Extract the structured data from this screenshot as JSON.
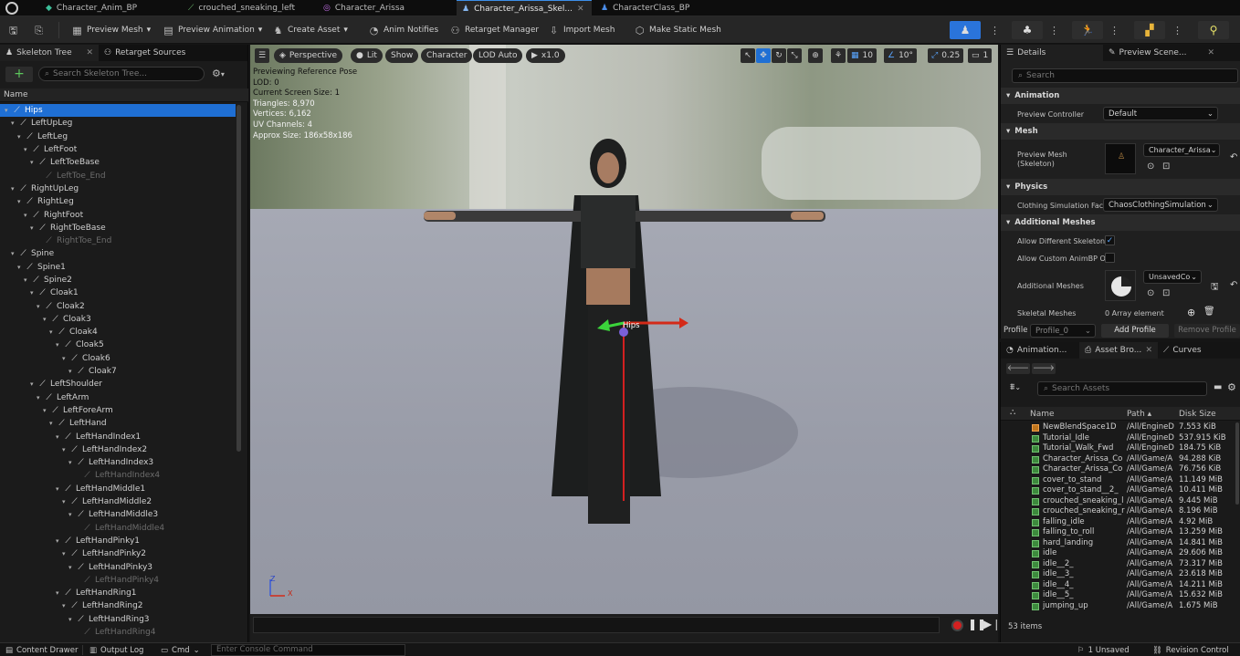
{
  "tabs": [
    {
      "label": "Character_Anim_BP",
      "icon": "anim-blueprint-icon"
    },
    {
      "label": "crouched_sneaking_left",
      "icon": "animation-icon"
    },
    {
      "label": "Character_Arissa",
      "icon": "skeletal-mesh-icon"
    },
    {
      "label": "Character_Arissa_Skel...",
      "icon": "skeleton-icon",
      "active": true
    },
    {
      "label": "CharacterClass_BP",
      "icon": "blueprint-icon"
    }
  ],
  "toolbar": {
    "preview_mesh": "Preview Mesh",
    "preview_animation": "Preview Animation",
    "create_asset": "Create Asset",
    "anim_notifies": "Anim Notifies",
    "retarget_manager": "Retarget Manager",
    "import_mesh": "Import Mesh",
    "make_static_mesh": "Make Static Mesh"
  },
  "left_panel": {
    "tab_skeleton_tree": "Skeleton Tree",
    "tab_retarget_sources": "Retarget Sources",
    "search_placeholder": "Search Skeleton Tree...",
    "column_name": "Name",
    "bones": [
      {
        "name": "Hips",
        "depth": 0,
        "selected": true
      },
      {
        "name": "LeftUpLeg",
        "depth": 1
      },
      {
        "name": "LeftLeg",
        "depth": 2
      },
      {
        "name": "LeftFoot",
        "depth": 3
      },
      {
        "name": "LeftToeBase",
        "depth": 4
      },
      {
        "name": "LeftToe_End",
        "depth": 5,
        "dim": true
      },
      {
        "name": "RightUpLeg",
        "depth": 1
      },
      {
        "name": "RightLeg",
        "depth": 2
      },
      {
        "name": "RightFoot",
        "depth": 3
      },
      {
        "name": "RightToeBase",
        "depth": 4
      },
      {
        "name": "RightToe_End",
        "depth": 5,
        "dim": true
      },
      {
        "name": "Spine",
        "depth": 1
      },
      {
        "name": "Spine1",
        "depth": 2
      },
      {
        "name": "Spine2",
        "depth": 3
      },
      {
        "name": "Cloak1",
        "depth": 4
      },
      {
        "name": "Cloak2",
        "depth": 5
      },
      {
        "name": "Cloak3",
        "depth": 6
      },
      {
        "name": "Cloak4",
        "depth": 7
      },
      {
        "name": "Cloak5",
        "depth": 8
      },
      {
        "name": "Cloak6",
        "depth": 9
      },
      {
        "name": "Cloak7",
        "depth": 10
      },
      {
        "name": "LeftShoulder",
        "depth": 4
      },
      {
        "name": "LeftArm",
        "depth": 5
      },
      {
        "name": "LeftForeArm",
        "depth": 6
      },
      {
        "name": "LeftHand",
        "depth": 7
      },
      {
        "name": "LeftHandIndex1",
        "depth": 8
      },
      {
        "name": "LeftHandIndex2",
        "depth": 9
      },
      {
        "name": "LeftHandIndex3",
        "depth": 10
      },
      {
        "name": "LeftHandIndex4",
        "depth": 11,
        "dim": true
      },
      {
        "name": "LeftHandMiddle1",
        "depth": 8
      },
      {
        "name": "LeftHandMiddle2",
        "depth": 9
      },
      {
        "name": "LeftHandMiddle3",
        "depth": 10
      },
      {
        "name": "LeftHandMiddle4",
        "depth": 11,
        "dim": true
      },
      {
        "name": "LeftHandPinky1",
        "depth": 8
      },
      {
        "name": "LeftHandPinky2",
        "depth": 9
      },
      {
        "name": "LeftHandPinky3",
        "depth": 10
      },
      {
        "name": "LeftHandPinky4",
        "depth": 11,
        "dim": true
      },
      {
        "name": "LeftHandRing1",
        "depth": 8
      },
      {
        "name": "LeftHandRing2",
        "depth": 9
      },
      {
        "name": "LeftHandRing3",
        "depth": 10
      },
      {
        "name": "LeftHandRing4",
        "depth": 11,
        "dim": true
      }
    ]
  },
  "viewport": {
    "perspective": "Perspective",
    "lit": "Lit",
    "show": "Show",
    "character": "Character",
    "lod": "LOD Auto",
    "speed": "x1.0",
    "grid_snap": "10",
    "rot_snap": "10°",
    "scale_snap": "0.25",
    "cam_speed": "1",
    "stats": {
      "line1": "Previewing Reference Pose",
      "line2": "LOD: 0",
      "line3": "Current Screen Size: 1",
      "line4": "Triangles: 8,970",
      "line5": "Vertices: 6,162",
      "line6": "UV Channels: 4",
      "line7": "Approx Size: 186x58x186"
    },
    "bone_label": "Hips",
    "axis_z": "Z",
    "axis_x": "X"
  },
  "details": {
    "tab_details": "Details",
    "tab_preview_scene": "Preview Scene...",
    "search_placeholder": "Search",
    "sections": {
      "animation": "Animation",
      "mesh": "Mesh",
      "physics": "Physics",
      "additional_meshes": "Additional Meshes"
    },
    "preview_controller_label": "Preview Controller",
    "preview_controller_value": "Default",
    "preview_mesh_label": "Preview Mesh (Skeleton)",
    "preview_mesh_value": "Character_Arissa",
    "clothing_label": "Clothing Simulation Fact",
    "clothing_value": "ChaosClothingSimulation",
    "allow_diff_skel_label": "Allow Different Skeleton",
    "allow_custom_label": "Allow Custom AnimBP O",
    "additional_meshes_label": "Additional Meshes",
    "additional_meshes_value": "UnsavedCo",
    "skeletal_meshes_label": "Skeletal Meshes",
    "skeletal_meshes_value": "0 Array element",
    "profile_label": "Profile",
    "profile_value": "Profile_0",
    "add_profile": "Add Profile",
    "remove_profile": "Remove Profile"
  },
  "asset_browser": {
    "tab_animation": "Animation...",
    "tab_asset_browser": "Asset Bro...",
    "tab_curves": "Curves",
    "search_placeholder": "Search Assets",
    "col_name": "Name",
    "col_path": "Path",
    "col_size": "Disk Size",
    "items_count": "53 items",
    "rows": [
      {
        "name": "NewBlendSpace1D",
        "path": "/All/EngineD",
        "size": "7.553 KiB",
        "type": "blendspace"
      },
      {
        "name": "Tutorial_Idle",
        "path": "/All/EngineD",
        "size": "537.915 KiB",
        "type": "anim"
      },
      {
        "name": "Tutorial_Walk_Fwd",
        "path": "/All/EngineD",
        "size": "184.75 KiB",
        "type": "anim"
      },
      {
        "name": "Character_Arissa_Co",
        "path": "/All/Game/A",
        "size": "94.288 KiB",
        "type": "anim"
      },
      {
        "name": "Character_Arissa_Co",
        "path": "/All/Game/A",
        "size": "76.756 KiB",
        "type": "anim"
      },
      {
        "name": "cover_to_stand",
        "path": "/All/Game/A",
        "size": "11.149 MiB",
        "type": "anim"
      },
      {
        "name": "cover_to_stand__2_",
        "path": "/All/Game/A",
        "size": "10.411 MiB",
        "type": "anim"
      },
      {
        "name": "crouched_sneaking_l",
        "path": "/All/Game/A",
        "size": "9.445 MiB",
        "type": "anim"
      },
      {
        "name": "crouched_sneaking_r",
        "path": "/All/Game/A",
        "size": "8.196 MiB",
        "type": "anim"
      },
      {
        "name": "falling_idle",
        "path": "/All/Game/A",
        "size": "4.92 MiB",
        "type": "anim"
      },
      {
        "name": "falling_to_roll",
        "path": "/All/Game/A",
        "size": "13.259 MiB",
        "type": "anim"
      },
      {
        "name": "hard_landing",
        "path": "/All/Game/A",
        "size": "14.841 MiB",
        "type": "anim"
      },
      {
        "name": "idle",
        "path": "/All/Game/A",
        "size": "29.606 MiB",
        "type": "anim"
      },
      {
        "name": "idle__2_",
        "path": "/All/Game/A",
        "size": "73.317 MiB",
        "type": "anim"
      },
      {
        "name": "idle__3_",
        "path": "/All/Game/A",
        "size": "23.618 MiB",
        "type": "anim"
      },
      {
        "name": "idle__4_",
        "path": "/All/Game/A",
        "size": "14.211 MiB",
        "type": "anim"
      },
      {
        "name": "idle__5_",
        "path": "/All/Game/A",
        "size": "15.632 MiB",
        "type": "anim"
      },
      {
        "name": "jumping_up",
        "path": "/All/Game/A",
        "size": "1.675 MiB",
        "type": "anim"
      }
    ]
  },
  "statusbar": {
    "content_drawer": "Content Drawer",
    "output_log": "Output Log",
    "cmd": "Cmd",
    "console_placeholder": "Enter Console Command",
    "unsaved": "1 Unsaved",
    "revision_control": "Revision Control"
  },
  "colors": {
    "accent": "#1f6fd4",
    "mode_button": "#2a74db",
    "add_green": "#5cc65c"
  }
}
